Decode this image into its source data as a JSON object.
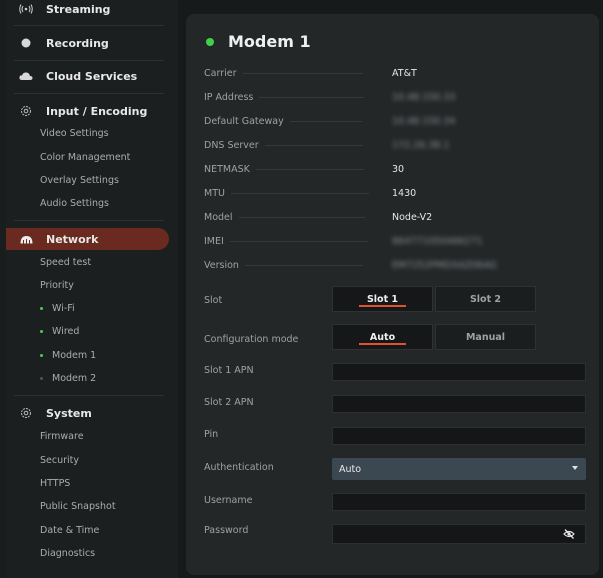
{
  "sidebar": {
    "streaming": "Streaming",
    "recording": "Recording",
    "cloud_services": "Cloud Services",
    "input_encoding": {
      "label": "Input / Encoding",
      "items": [
        "Video Settings",
        "Color Management",
        "Overlay Settings",
        "Audio Settings"
      ]
    },
    "network": {
      "label": "Network",
      "items": [
        "Speed test",
        "Priority"
      ],
      "interfaces": [
        {
          "label": "Wi-Fi",
          "connected": true
        },
        {
          "label": "Wired",
          "connected": true
        },
        {
          "label": "Modem 1",
          "connected": true
        },
        {
          "label": "Modem 2",
          "connected": false
        }
      ]
    },
    "system": {
      "label": "System",
      "items": [
        "Firmware",
        "Security",
        "HTTPS",
        "Public Snapshot",
        "Date & Time",
        "Diagnostics"
      ]
    }
  },
  "panel": {
    "title": "Modem 1",
    "status_color": "#3fd14a",
    "info": [
      {
        "label": "Carrier",
        "value": "AT&T",
        "blurred": false
      },
      {
        "label": "IP Address",
        "value": "10.48.150.33",
        "blurred": true
      },
      {
        "label": "Default Gateway",
        "value": "10.48.150.34",
        "blurred": true
      },
      {
        "label": "DNS Server",
        "value": "172.26.38.1",
        "blurred": true
      },
      {
        "label": "NETMASK",
        "value": "30",
        "blurred": false
      },
      {
        "label": "MTU",
        "value": "1430",
        "blurred": false
      },
      {
        "label": "Model",
        "value": "Node-V2",
        "blurred": false
      },
      {
        "label": "IMEI",
        "value": "864771050466271",
        "blurred": true
      },
      {
        "label": "Version",
        "value": "EM7252PMDXAZ06AG",
        "blurred": true
      }
    ],
    "slot": {
      "label": "Slot",
      "options": [
        "Slot 1",
        "Slot 2"
      ],
      "selected": "Slot 1"
    },
    "config_mode": {
      "label": "Configuration mode",
      "options": [
        "Auto",
        "Manual"
      ],
      "selected": "Auto"
    },
    "slot1_apn": {
      "label": "Slot 1 APN",
      "value": ""
    },
    "slot2_apn": {
      "label": "Slot 2 APN",
      "value": ""
    },
    "pin": {
      "label": "Pin",
      "value": ""
    },
    "authentication": {
      "label": "Authentication",
      "value": "Auto"
    },
    "username": {
      "label": "Username",
      "value": ""
    },
    "password": {
      "label": "Password",
      "value": ""
    },
    "accent_color": "#e0532d"
  }
}
